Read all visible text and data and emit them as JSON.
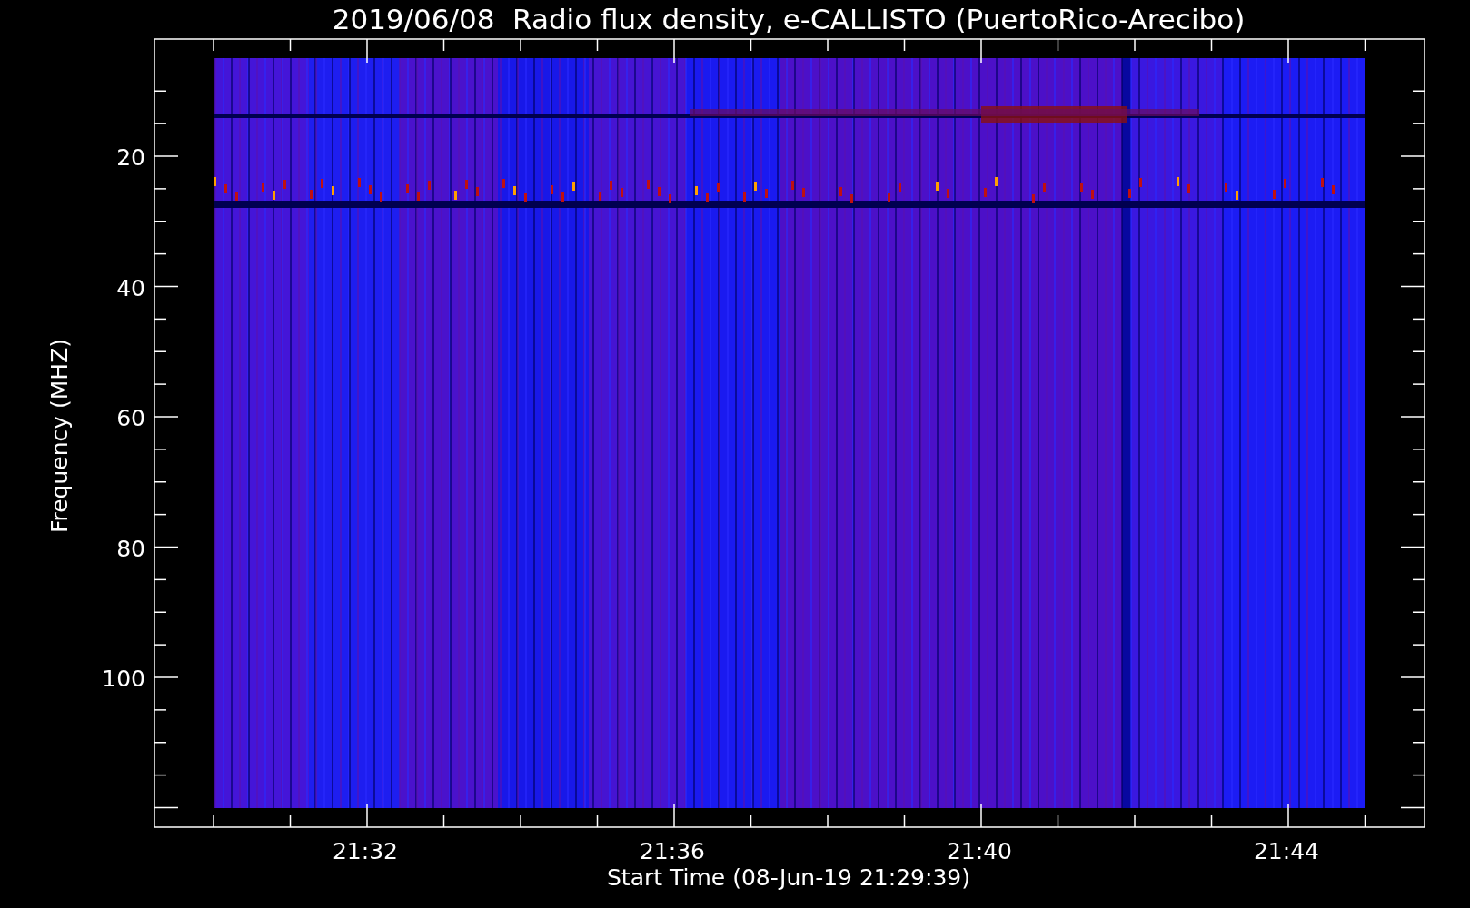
{
  "plot": {
    "title": "2019/06/08  Radio flux density, e-CALLISTO (PuertoRico-Arecibo)",
    "ylabel": "Frequency (MHZ)",
    "xlabel": "Start Time (08-Jun-19 21:29:39)",
    "yticks": [
      "20",
      "40",
      "60",
      "80",
      "100"
    ],
    "xticks": [
      "21:32",
      "21:36",
      "21:40",
      "21:44"
    ]
  }
}
